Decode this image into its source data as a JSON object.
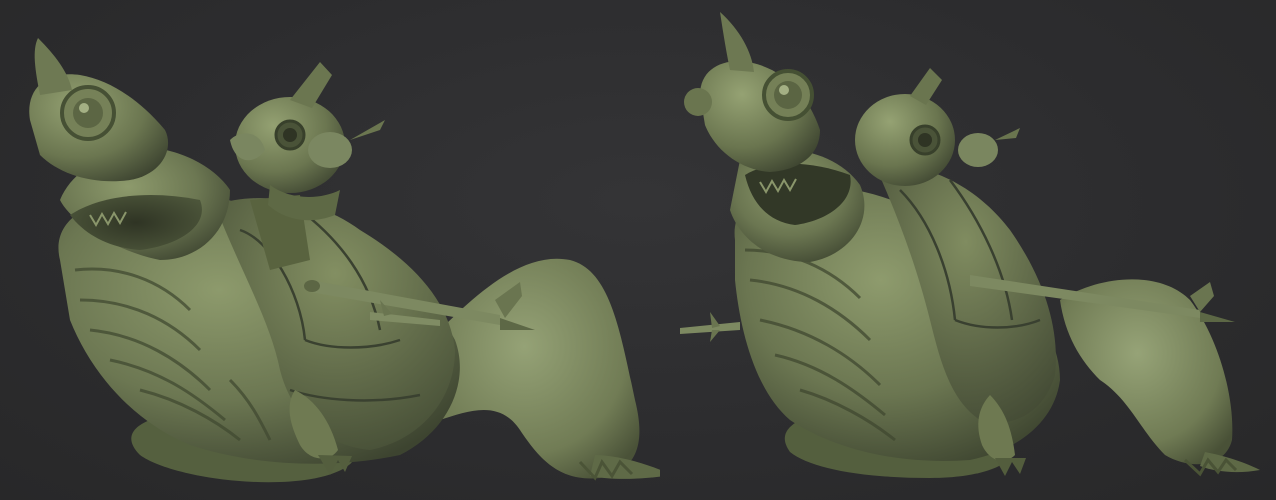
{
  "scene": {
    "background_color": "#2e2e30",
    "model_color": "#6f7a55",
    "model_shadow_color": "#3f4630",
    "model_highlight_color": "#97a37a",
    "views": [
      {
        "name": "sculpt-view-front-three-quarter"
      },
      {
        "name": "sculpt-view-side-three-quarter"
      }
    ]
  }
}
